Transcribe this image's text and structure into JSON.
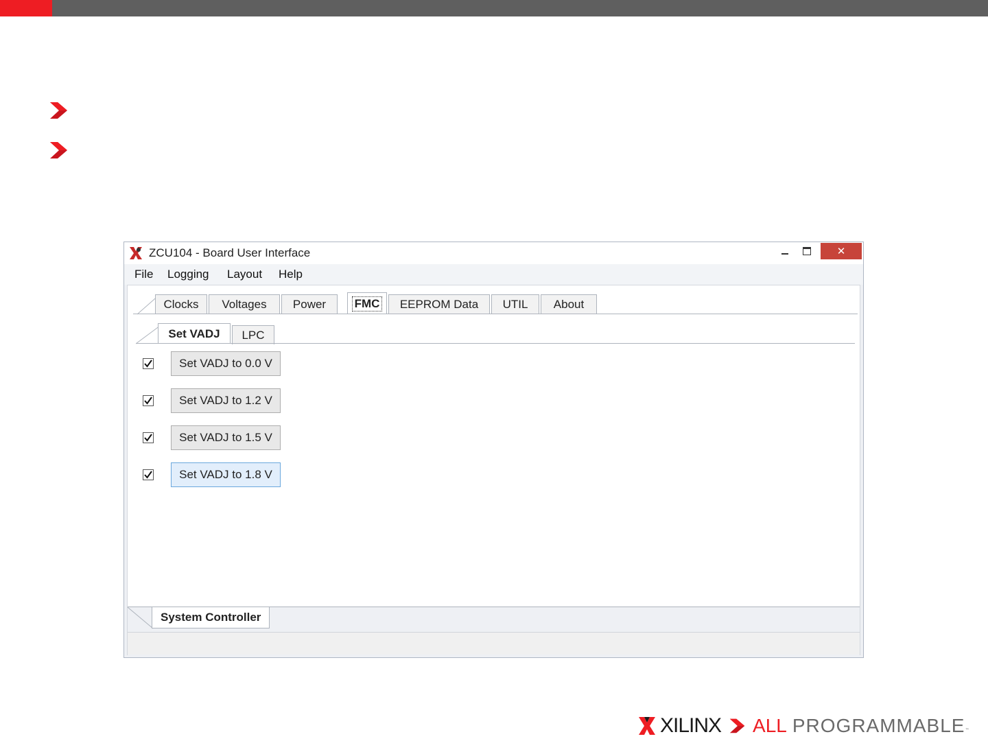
{
  "slide": {
    "brand": "XILINX",
    "tagline_all": "ALL",
    "tagline_rest": "PROGRAMMABLE",
    "trademark": "™",
    "colors": {
      "accent": "#ee1d23",
      "topbar": "#5f5f5f"
    }
  },
  "window": {
    "title": "ZCU104 - Board User Interface",
    "close_glyph": "✕",
    "menu": [
      {
        "label": "File"
      },
      {
        "label": "Logging"
      },
      {
        "label": "Layout"
      },
      {
        "label": "Help"
      }
    ],
    "tabs": [
      {
        "label": "Clocks"
      },
      {
        "label": "Voltages"
      },
      {
        "label": "Power"
      },
      {
        "label": "FMC",
        "selected": true
      },
      {
        "label": "EEPROM Data"
      },
      {
        "label": "UTIL"
      },
      {
        "label": "About"
      }
    ],
    "subtabs": [
      {
        "label": "Set VADJ",
        "selected": true
      },
      {
        "label": "LPC"
      }
    ],
    "vadj_rows": [
      {
        "checked": true,
        "button": "Set VADJ to 0.0 V"
      },
      {
        "checked": true,
        "button": "Set VADJ to 1.2 V"
      },
      {
        "checked": true,
        "button": "Set VADJ to 1.5 V"
      },
      {
        "checked": true,
        "button": "Set VADJ to 1.8 V",
        "hover": true
      }
    ],
    "bottom_tab": "System Controller"
  }
}
